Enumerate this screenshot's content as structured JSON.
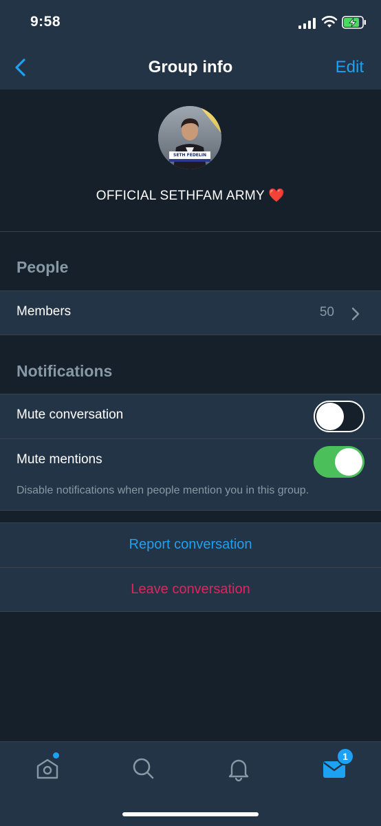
{
  "status_bar": {
    "time": "9:58"
  },
  "nav": {
    "title": "Group info",
    "edit_label": "Edit"
  },
  "group": {
    "name": "OFFICIAL SETHFAM ARMY",
    "emoji": "❤️",
    "avatar_caption": "SETH FEDELIN"
  },
  "sections": {
    "people": {
      "title": "People",
      "members_label": "Members",
      "members_count": "50"
    },
    "notifications": {
      "title": "Notifications",
      "mute_conversation_label": "Mute conversation",
      "mute_conversation_on": false,
      "mute_mentions_label": "Mute mentions",
      "mute_mentions_on": true,
      "mute_mentions_hint": "Disable notifications when people mention you in this group."
    }
  },
  "actions": {
    "report_label": "Report conversation",
    "leave_label": "Leave conversation"
  },
  "tabbar": {
    "items": [
      "home-icon",
      "search-icon",
      "notifications-icon",
      "messages-icon"
    ],
    "messages_badge": "1"
  },
  "colors": {
    "accent": "#1da1f2",
    "danger": "#e0245e",
    "toggle_on": "#4bbf5a",
    "background": "#15202b",
    "surface": "#243447"
  }
}
